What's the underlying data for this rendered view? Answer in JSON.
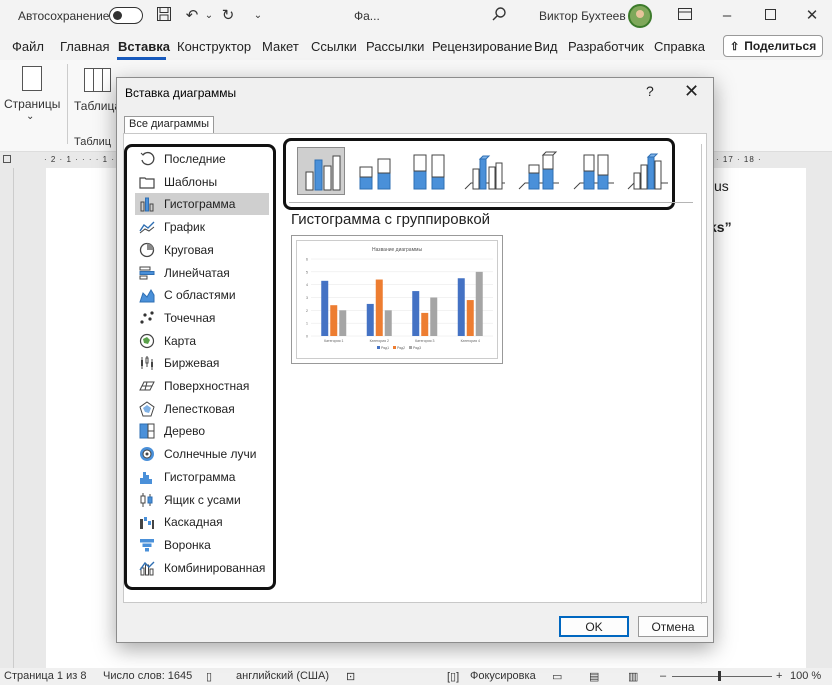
{
  "titlebar": {
    "autosave_label": "Автосохранение",
    "doc_title": "Фа...",
    "user_name": "Виктор Бухтеев"
  },
  "menu": {
    "items": [
      "Файл",
      "Главная",
      "Вставка",
      "Конструктор",
      "Макет",
      "Ссылки",
      "Рассылки",
      "Рецензирование",
      "Вид",
      "Разработчик",
      "Справка"
    ],
    "active": "Вставка",
    "share_label": "Поделиться"
  },
  "ribbon": {
    "pages_label": "Страницы",
    "table_label": "Таблица",
    "tables_group_label": "Таблиц"
  },
  "document": {
    "fragment1": "us",
    "fragment2": "ks”"
  },
  "dialog": {
    "title": "Вставка диаграммы",
    "help": "?",
    "close": "✕",
    "tab_label": "Все диаграммы",
    "categories": [
      {
        "label": "Последние",
        "icon": "recent-icon"
      },
      {
        "label": "Шаблоны",
        "icon": "templates-icon"
      },
      {
        "label": "Гистограмма",
        "icon": "column-chart-icon"
      },
      {
        "label": "График",
        "icon": "line-chart-icon"
      },
      {
        "label": "Круговая",
        "icon": "pie-chart-icon"
      },
      {
        "label": "Линейчатая",
        "icon": "bar-chart-icon"
      },
      {
        "label": "С областями",
        "icon": "area-chart-icon"
      },
      {
        "label": "Точечная",
        "icon": "scatter-chart-icon"
      },
      {
        "label": "Карта",
        "icon": "map-chart-icon"
      },
      {
        "label": "Биржевая",
        "icon": "stock-chart-icon"
      },
      {
        "label": "Поверхностная",
        "icon": "surface-chart-icon"
      },
      {
        "label": "Лепестковая",
        "icon": "radar-chart-icon"
      },
      {
        "label": "Дерево",
        "icon": "treemap-chart-icon"
      },
      {
        "label": "Солнечные лучи",
        "icon": "sunburst-chart-icon"
      },
      {
        "label": "Гистограмма",
        "icon": "histogram-chart-icon"
      },
      {
        "label": "Ящик с усами",
        "icon": "box-whisker-chart-icon"
      },
      {
        "label": "Каскадная",
        "icon": "waterfall-chart-icon"
      },
      {
        "label": "Воронка",
        "icon": "funnel-chart-icon"
      },
      {
        "label": "Комбинированная",
        "icon": "combo-chart-icon"
      }
    ],
    "selected_category": "Гистограмма",
    "selected_subtype_title": "Гистограмма с группировкой",
    "ok_label": "OK",
    "cancel_label": "Отмена"
  },
  "preview_chart": {
    "title": "Название диаграммы",
    "categories": [
      "Категория 1",
      "Категория 2",
      "Категория 3",
      "Категория 4"
    ],
    "series": [
      {
        "name": "Ряд1",
        "values": [
          4.3,
          2.5,
          3.5,
          4.5
        ],
        "color": "#4472c4"
      },
      {
        "name": "Ряд2",
        "values": [
          2.4,
          4.4,
          1.8,
          2.8
        ],
        "color": "#ed7d31"
      },
      {
        "name": "Ряд3",
        "values": [
          2,
          2,
          3,
          5
        ],
        "color": "#a5a5a5"
      }
    ],
    "y_ticks": [
      "6",
      "5",
      "4",
      "3",
      "2",
      "1",
      "0"
    ]
  },
  "statusbar": {
    "page_info": "Страница 1 из 8",
    "word_count": "Число слов: 1645",
    "language": "английский (США)",
    "focus": "Фокусировка",
    "zoom": "100 %"
  }
}
